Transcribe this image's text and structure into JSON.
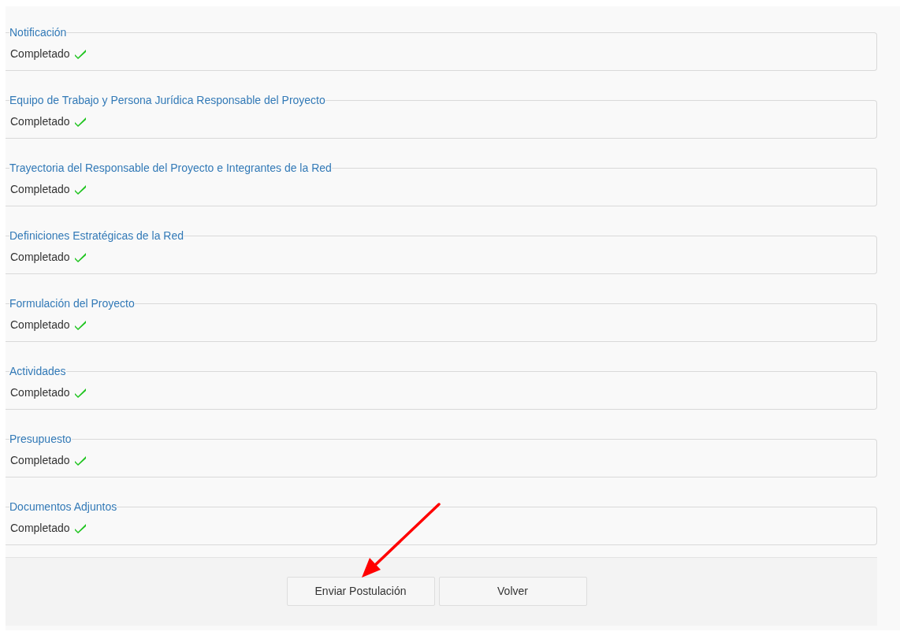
{
  "sections": [
    {
      "title": "Notificación",
      "status": "Completado",
      "completed": true
    },
    {
      "title": "Equipo de Trabajo y Persona Jurídica Responsable del Proyecto",
      "status": "Completado",
      "completed": true
    },
    {
      "title": "Trayectoria del Responsable del Proyecto e Integrantes de la Red",
      "status": "Completado",
      "completed": true
    },
    {
      "title": "Definiciones Estratégicas de la Red",
      "status": "Completado",
      "completed": true
    },
    {
      "title": "Formulación del Proyecto",
      "status": "Completado",
      "completed": true
    },
    {
      "title": "Actividades",
      "status": "Completado",
      "completed": true
    },
    {
      "title": "Presupuesto",
      "status": "Completado",
      "completed": true
    },
    {
      "title": "Documentos Adjuntos",
      "status": "Completado",
      "completed": true
    }
  ],
  "buttons": [
    "Enviar Postulación",
    "Volver"
  ]
}
